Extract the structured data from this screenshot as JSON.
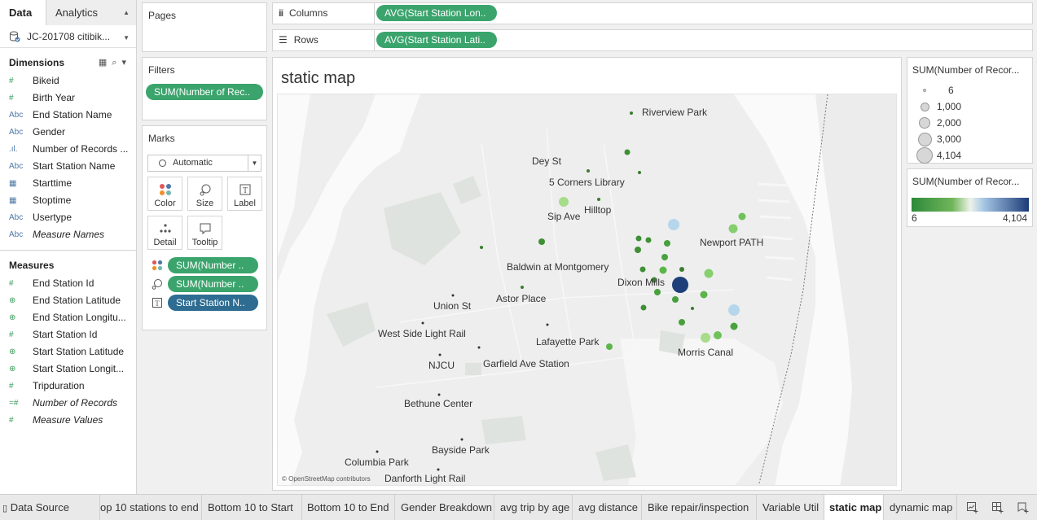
{
  "pane_tabs": {
    "data": "Data",
    "analytics": "Analytics"
  },
  "datasource": "JC-201708 citibik...",
  "dimensions": {
    "title": "Dimensions",
    "fields": [
      {
        "type": "#",
        "name": "Bikeid",
        "italic": false
      },
      {
        "type": "#",
        "name": "Birth Year",
        "italic": false
      },
      {
        "type": "Abc",
        "name": "End Station Name",
        "italic": false
      },
      {
        "type": "Abc",
        "name": "Gender",
        "italic": false
      },
      {
        "type": ".ıl.",
        "name": "Number of Records ...",
        "italic": false
      },
      {
        "type": "Abc",
        "name": "Start Station Name",
        "italic": false
      },
      {
        "type": "cal",
        "name": "Starttime",
        "italic": false
      },
      {
        "type": "cal",
        "name": "Stoptime",
        "italic": false
      },
      {
        "type": "Abc",
        "name": "Usertype",
        "italic": false
      },
      {
        "type": "Abc",
        "name": "Measure Names",
        "italic": true
      }
    ]
  },
  "measures": {
    "title": "Measures",
    "fields": [
      {
        "type": "#",
        "name": "End Station Id",
        "italic": false
      },
      {
        "type": "globe",
        "name": "End Station Latitude",
        "italic": false
      },
      {
        "type": "globe",
        "name": "End Station Longitu...",
        "italic": false
      },
      {
        "type": "#",
        "name": "Start Station Id",
        "italic": false
      },
      {
        "type": "globe",
        "name": "Start Station Latitude",
        "italic": false
      },
      {
        "type": "globe",
        "name": "Start Station Longit...",
        "italic": false
      },
      {
        "type": "#",
        "name": "Tripduration",
        "italic": false
      },
      {
        "type": "=#",
        "name": "Number of Records",
        "italic": true
      },
      {
        "type": "#",
        "name": "Measure Values",
        "italic": true
      }
    ]
  },
  "pages": {
    "title": "Pages"
  },
  "filters": {
    "title": "Filters",
    "pill": "SUM(Number of Rec.."
  },
  "marks": {
    "title": "Marks",
    "mark_type": "Automatic",
    "buttons": {
      "color": "Color",
      "size": "Size",
      "label": "Label",
      "detail": "Detail",
      "tooltip": "Tooltip"
    },
    "pills": {
      "color": "SUM(Number ..",
      "size": "SUM(Number ..",
      "label": "Start Station N.."
    }
  },
  "shelves": {
    "columns": {
      "label": "Columns",
      "pill": "AVG(Start Station Lon.."
    },
    "rows": {
      "label": "Rows",
      "pill": "AVG(Start Station Lati.."
    }
  },
  "view": {
    "title": "static map",
    "attribution": "© OpenStreetMap contributors"
  },
  "map_labels": {
    "riverview_park": "Riverview Park",
    "dey_st": "Dey St",
    "five_corners": "5 Corners Library",
    "hilltop": "Hilltop",
    "sip_ave": "Sip Ave",
    "newport_path": "Newport PATH",
    "baldwin": "Baldwin at Montgomery",
    "dixon_mills": "Dixon Mills",
    "astor_place": "Astor Place",
    "union_st": "Union St",
    "west_side": "West Side Light Rail",
    "lafayette": "Lafayette Park",
    "njcu": "NJCU",
    "garfield": "Garfield Ave Station",
    "morris_canal": "Morris Canal",
    "bethune": "Bethune Center",
    "bayside": "Bayside Park",
    "columbia": "Columbia Park",
    "danforth": "Danforth Light Rail"
  },
  "size_legend": {
    "title": "SUM(Number of Recor...",
    "items": [
      "6",
      "1,000",
      "2,000",
      "3,000",
      "4,104"
    ]
  },
  "color_legend": {
    "title": "SUM(Number of Recor...",
    "min": "6",
    "max": "4,104"
  },
  "sheet_tabs": {
    "data_source": "Data Source",
    "top10": "op 10 stations to end",
    "bottom10_start": "Bottom 10 to Start",
    "bottom10_end": "Bottom 10 to End",
    "gender": "Gender Breakdown",
    "avg_trip_age": "avg trip by age",
    "avg_distance": "avg distance",
    "bike_repair": "Bike repair/inspection",
    "variable_util": "Variable Util",
    "static_map": "static map",
    "dynamic_map": "dynamic map"
  },
  "colors": {
    "green_pill": "#3aa46c",
    "blue_pill": "#2e6c91",
    "dark_green": "#3f9a3f",
    "light_green": "#8fd07a",
    "light_blue": "#a9d0ea",
    "dark_blue": "#1f3f7a"
  }
}
